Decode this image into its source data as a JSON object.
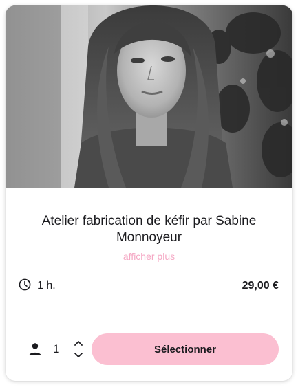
{
  "product": {
    "title": "Atelier fabrication de kéfir par Sabine Monnoyeur",
    "more_link": "afficher plus",
    "duration": "1 h.",
    "price": "29,00 €",
    "quantity": "1",
    "select_label": "Sélectionner"
  },
  "colors": {
    "accent_pink": "#fbbfd1",
    "link_pink": "#f5a8c4",
    "text_dark": "#1b1b1f"
  },
  "icons": {
    "duration": "clock-icon",
    "quantity": "person-icon",
    "increment": "chevron-up-icon",
    "decrement": "chevron-down-icon"
  }
}
